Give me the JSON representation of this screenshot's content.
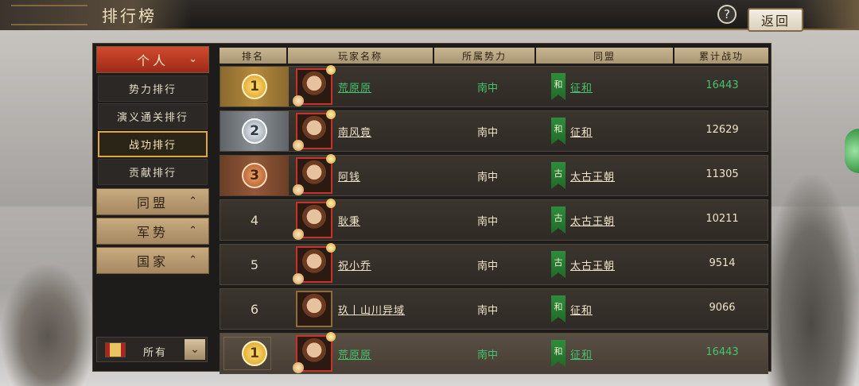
{
  "header": {
    "title": "排行榜",
    "help_label": "?",
    "back_label": "返回"
  },
  "sidebar": {
    "categories": [
      {
        "label": "个人",
        "expanded": true,
        "chevron": "chevron-down-icon"
      },
      {
        "label": "同盟",
        "expanded": false,
        "chevron": "chevron-up-icon"
      },
      {
        "label": "军势",
        "expanded": false,
        "chevron": "chevron-up-icon"
      },
      {
        "label": "国家",
        "expanded": false,
        "chevron": "chevron-up-icon"
      }
    ],
    "sub_items": [
      "势力排行",
      "演义通关排行",
      "战功排行",
      "贡献排行"
    ],
    "selected_sub_item": "战功排行",
    "filter": {
      "label": "所有",
      "icon": "scroll-icon"
    }
  },
  "table": {
    "headers": [
      "排名",
      "玩家名称",
      "所属势力",
      "同盟",
      "累计战功"
    ],
    "rows": [
      {
        "rank": "1",
        "medal": "gold",
        "name": "荒原原",
        "faction": "南中",
        "alliance_badge": "和",
        "alliance": "征和",
        "score": "16443",
        "highlight": true
      },
      {
        "rank": "2",
        "medal": "silver",
        "name": "南风竟",
        "faction": "南中",
        "alliance_badge": "和",
        "alliance": "征和",
        "score": "12629",
        "highlight": false
      },
      {
        "rank": "3",
        "medal": "bronze",
        "name": "阿钱",
        "faction": "南中",
        "alliance_badge": "古",
        "alliance": "太古王朝",
        "score": "11305",
        "highlight": false
      },
      {
        "rank": "4",
        "medal": "",
        "name": "耿秉",
        "faction": "南中",
        "alliance_badge": "古",
        "alliance": "太古王朝",
        "score": "10211",
        "highlight": false
      },
      {
        "rank": "5",
        "medal": "",
        "name": "祝小乔",
        "faction": "南中",
        "alliance_badge": "古",
        "alliance": "太古王朝",
        "score": "9514",
        "highlight": false
      },
      {
        "rank": "6",
        "medal": "",
        "name": "玖丨山川异域",
        "faction": "南中",
        "alliance_badge": "和",
        "alliance": "征和",
        "score": "9066",
        "highlight": false
      }
    ],
    "my_row": {
      "rank": "1",
      "medal": "gold",
      "name": "荒原原",
      "faction": "南中",
      "alliance_badge": "和",
      "alliance": "征和",
      "score": "16443",
      "highlight": true
    }
  },
  "colors": {
    "highlight_text": "#45c46b",
    "accent_gold": "#e0a73d",
    "active_tab": "#d24a2e"
  }
}
